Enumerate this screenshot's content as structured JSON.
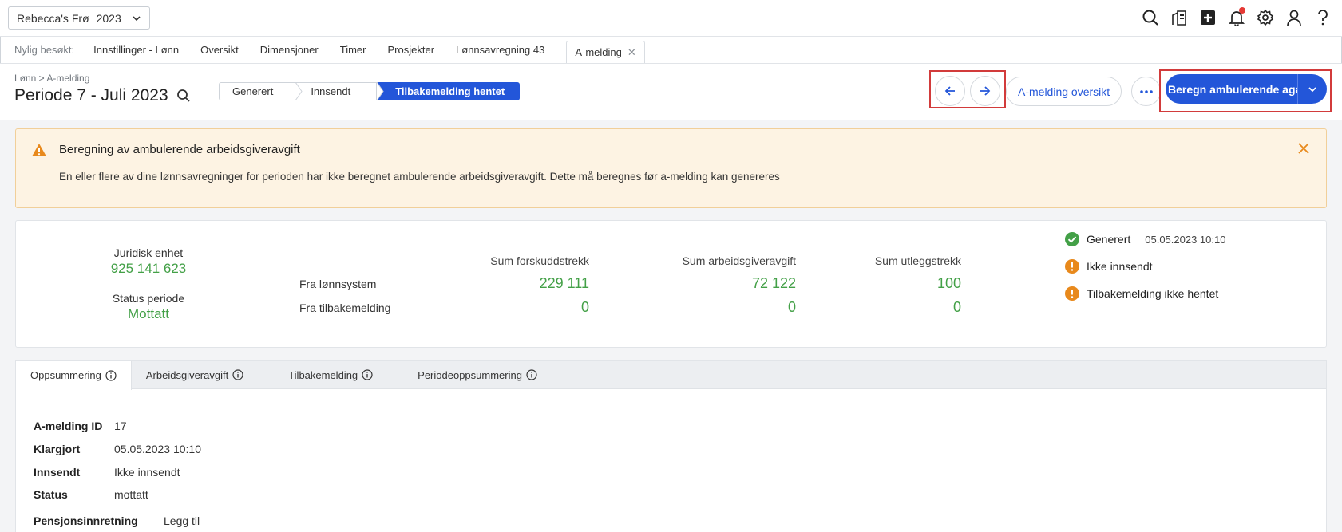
{
  "topbar": {
    "company": "Rebecca's Frø",
    "year": "2023",
    "icons": [
      "search-icon",
      "building-icon",
      "plus-square-icon",
      "bell-icon",
      "gear-icon",
      "user-icon",
      "help-icon"
    ],
    "notification_dot_color": "#e53935"
  },
  "recent": {
    "label": "Nylig besøkt:",
    "links": [
      "Innstillinger - Lønn",
      "Oversikt",
      "Dimensjoner",
      "Timer",
      "Prosjekter",
      "Lønnsavregning 43"
    ],
    "active": "A-melding"
  },
  "header": {
    "breadcrumb": "Lønn > A-melding",
    "title": "Periode 7 - Juli 2023",
    "steps": [
      "Generert",
      "Innsendt",
      "Tilbakemelding hentet"
    ],
    "overview_button": "A-melding oversikt",
    "calc_button": "Beregn ambulerende aga",
    "accent_color": "#2356d9"
  },
  "warning": {
    "title": "Beregning av ambulerende arbeidsgiveravgift",
    "text": "En eller flere av dine lønnsavregninger for perioden har ikke beregnet ambulerende arbeidsgiveravgift. Dette må beregnes før a-melding kan genereres"
  },
  "summary": {
    "entity_label": "Juridisk enhet",
    "entity_value": "925 141 623",
    "status_label": "Status periode",
    "status_value": "Mottatt",
    "columns": [
      "Sum forskuddstrekk",
      "Sum arbeidsgiveravgift",
      "Sum utleggstrekk"
    ],
    "rows": [
      {
        "label": "Fra lønnsystem",
        "values": [
          "229 111",
          "72 122",
          "100"
        ]
      },
      {
        "label": "Fra tilbakemelding",
        "values": [
          "0",
          "0",
          "0"
        ]
      }
    ],
    "statuses": [
      {
        "label": "Generert",
        "date": "05.05.2023 10:10",
        "state": "ok"
      },
      {
        "label": "Ikke innsendt",
        "date": "",
        "state": "warn"
      },
      {
        "label": "Tilbakemelding ikke hentet",
        "date": "",
        "state": "warn"
      }
    ]
  },
  "tabs": [
    "Oppsummering",
    "Arbeidsgiveravgift",
    "Tilbakemelding",
    "Periodeoppsummering"
  ],
  "details": {
    "id_label": "A-melding ID",
    "id_value": "17",
    "ready_label": "Klargjort",
    "ready_value": "05.05.2023 10:10",
    "sent_label": "Innsendt",
    "sent_value": "Ikke innsendt",
    "status_label": "Status",
    "status_value": "mottatt",
    "pension_label": "Pensjonsinnretning",
    "pension_link": "Legg til"
  }
}
